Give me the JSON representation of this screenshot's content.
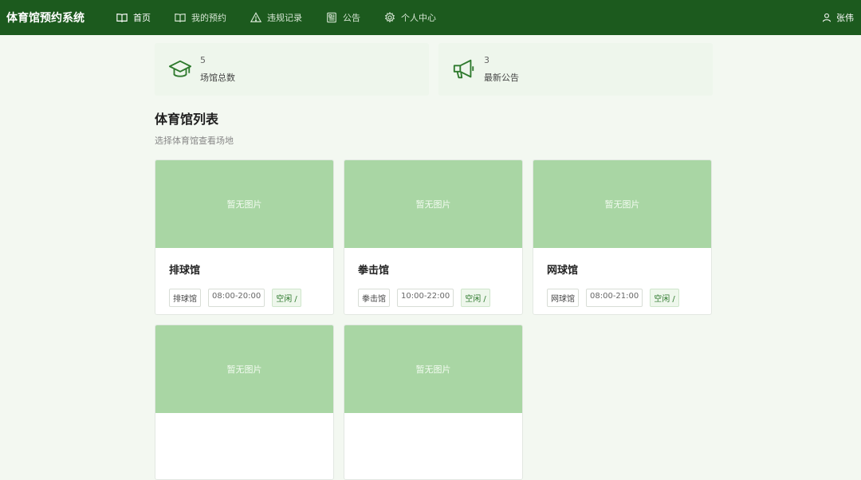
{
  "nav": {
    "brand": "体育馆预约系统",
    "items": [
      {
        "label": "首页",
        "icon": "book-open-icon"
      },
      {
        "label": "我的预约",
        "icon": "book-icon"
      },
      {
        "label": "违规记录",
        "icon": "warning-icon"
      },
      {
        "label": "公告",
        "icon": "newspaper-icon"
      },
      {
        "label": "个人中心",
        "icon": "gear-icon"
      }
    ],
    "user": "张伟"
  },
  "stats": [
    {
      "value": "5",
      "label": "场馆总数",
      "icon": "graduation-cap-icon"
    },
    {
      "value": "3",
      "label": "最新公告",
      "icon": "megaphone-icon"
    }
  ],
  "section": {
    "title": "体育馆列表",
    "subtitle": "选择体育馆查看场地"
  },
  "cards": [
    {
      "image_placeholder": "暂无图片",
      "name": "排球馆",
      "type_tag": "排球馆",
      "hours": "08:00-20:00",
      "status": "空闲 /"
    },
    {
      "image_placeholder": "暂无图片",
      "name": "拳击馆",
      "type_tag": "拳击馆",
      "hours": "10:00-22:00",
      "status": "空闲 /"
    },
    {
      "image_placeholder": "暂无图片",
      "name": "网球馆",
      "type_tag": "网球馆",
      "hours": "08:00-21:00",
      "status": "空闲 /"
    },
    {
      "image_placeholder": "暂无图片"
    },
    {
      "image_placeholder": "暂无图片"
    }
  ],
  "colors": {
    "navbar": "#1c5a1e",
    "page_bg": "#f3f8f1",
    "card_image": "#a9d6a4",
    "accent": "#2f7a2e"
  }
}
